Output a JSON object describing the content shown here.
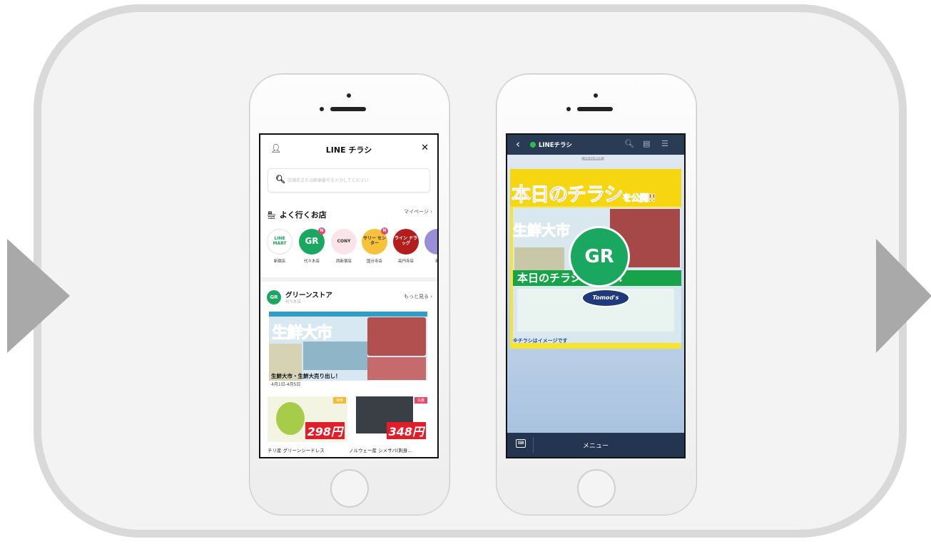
{
  "phone1": {
    "header": {
      "title": "LINE チラシ",
      "user_icon": "user-icon",
      "close_icon": "close-icon",
      "close_glyph": "✕"
    },
    "search": {
      "placeholder": "店舗名または郵便番号を入力してください",
      "icon": "search-icon"
    },
    "frequent": {
      "title": "よく行くお店",
      "more": "マイページ ›"
    },
    "stores": [
      {
        "logo": "LINE MART",
        "name": "新宿店",
        "color": "#ffffff",
        "text_color": "#1aa861",
        "badge": ""
      },
      {
        "logo": "GR",
        "name": "代々木店",
        "color": "#1aa861",
        "text_color": "#ffffff",
        "badge": "N"
      },
      {
        "logo": "CONY",
        "name": "西新宿店",
        "color": "#fbe3ea",
        "text_color": "#333333",
        "badge": ""
      },
      {
        "logo": "サリー センター",
        "name": "国分寺店",
        "color": "#f7c23a",
        "text_color": "#333333",
        "badge": "N"
      },
      {
        "logo": "ライン ドラッグ",
        "name": "高円寺店",
        "color": "#b31d1d",
        "text_color": "#ffffff",
        "badge": ""
      },
      {
        "logo": "",
        "name": "新",
        "color": "#9a8fd6",
        "text_color": "#ffffff",
        "badge": ""
      }
    ],
    "shop": {
      "logo": "GR",
      "name": "グリーンストア",
      "branch": "代々木店",
      "more": "もっと見る ›"
    },
    "flyer": {
      "headline": "生鮮大市",
      "caption": "生鮮大市・生鮮大売り出し！",
      "date": "4月1日-4月5日"
    },
    "products": [
      {
        "tag": "特価",
        "tag_color": "#f5b82e",
        "price": "298円",
        "name": "チリ産 グリーンシードレス"
      },
      {
        "tag": "先着",
        "tag_color": "#e8466a",
        "price": "348円",
        "name": "ノルウェー産 シメサバ(刺身..."
      }
    ]
  },
  "phone2": {
    "nav": {
      "title": "LINEチラシ",
      "back": "‹",
      "search_icon": "search-icon",
      "note_icon": "note-icon",
      "menu_icon": "hamburger-icon"
    },
    "timestamp": "14:15 MAX",
    "card": {
      "headline": "本日のチラシ",
      "headline_suffix": "を公開!!",
      "sub_headline": "生鮮大市",
      "strip": "本日のチラシを公開!!",
      "store_logo": "GR",
      "partner_logo": "Tomod's",
      "footer": "※チラシはイメージです"
    },
    "bottom": {
      "menu": "メニュー",
      "keyboard_icon": "keyboard-icon"
    }
  },
  "arrows": {
    "left": "arrow-right-icon",
    "right": "arrow-right-icon"
  }
}
